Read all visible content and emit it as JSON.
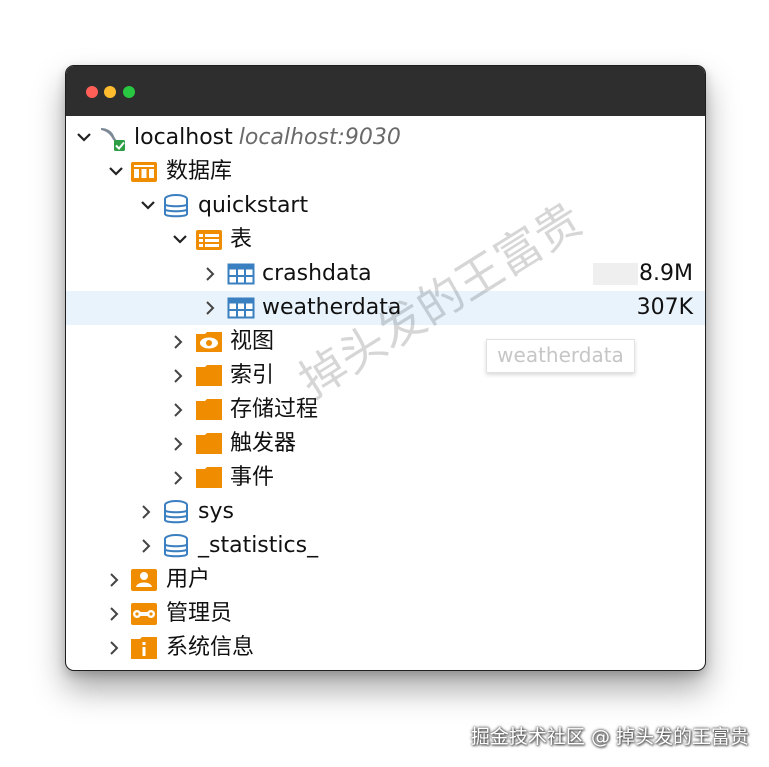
{
  "window": {
    "controls": [
      "close",
      "minimize",
      "zoom"
    ]
  },
  "tree": {
    "connection": {
      "label": "localhost",
      "address": "localhost:9030",
      "icon": "connection-icon"
    },
    "databases": {
      "label": "数据库",
      "icon": "database-group-icon"
    },
    "quickstart": {
      "label": "quickstart",
      "icon": "database-icon"
    },
    "tables": {
      "label": "表",
      "icon": "table-group-icon"
    },
    "table_rows": [
      {
        "label": "crashdata",
        "size": "8.9M",
        "fill": 0.45
      },
      {
        "label": "weatherdata",
        "size": "307K",
        "fill": 0.05
      }
    ],
    "views": {
      "label": "视图",
      "icon": "eye-icon"
    },
    "indexes": {
      "label": "索引"
    },
    "procedures": {
      "label": "存储过程"
    },
    "triggers": {
      "label": "触发器"
    },
    "events": {
      "label": "事件"
    },
    "sys": {
      "label": "sys"
    },
    "statistics": {
      "label": "_statistics_"
    },
    "users": {
      "label": "用户"
    },
    "admins": {
      "label": "管理员"
    },
    "sysinfo": {
      "label": "系统信息"
    }
  },
  "tooltip": {
    "text": "weatherdata"
  },
  "watermark": {
    "diagonal": "掉头发的王富贵",
    "footer": "掘金技术社区 @ 掉头发的王富贵"
  },
  "colors": {
    "folder": "#f08c00",
    "db": "#3a7fbf",
    "selected_row": "#e9f3fb",
    "titlebar": "#2e2e2e"
  }
}
